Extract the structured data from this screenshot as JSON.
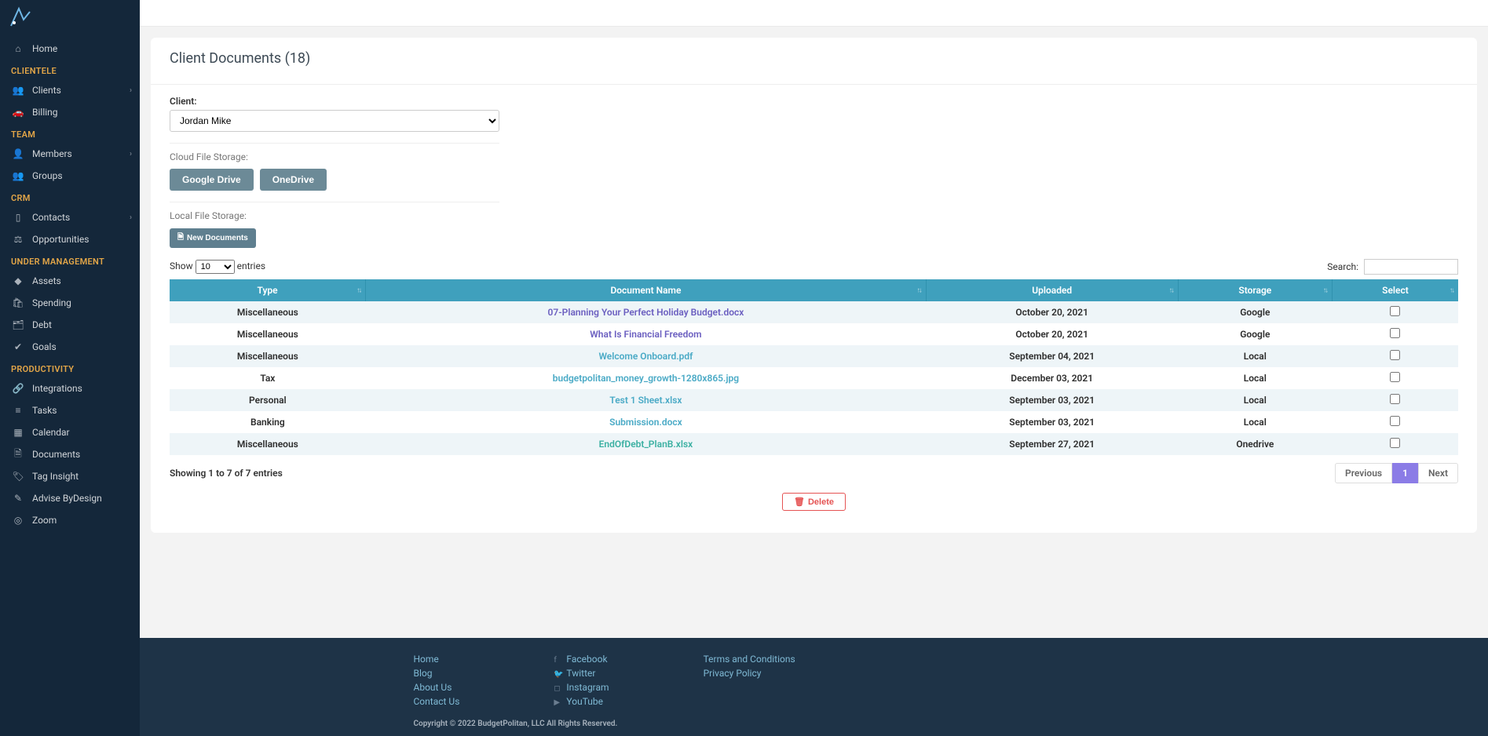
{
  "sidebar": {
    "items": [
      {
        "section": null,
        "label": "Home",
        "icon": "⌂",
        "hasSub": false
      },
      {
        "section": "CLIENTELE",
        "label": "Clients",
        "icon": "👥",
        "hasSub": true
      },
      {
        "section": null,
        "label": "Billing",
        "icon": "🚗",
        "hasSub": false
      },
      {
        "section": "TEAM",
        "label": "Members",
        "icon": "👤",
        "hasSub": true
      },
      {
        "section": null,
        "label": "Groups",
        "icon": "👥",
        "hasSub": false
      },
      {
        "section": "CRM",
        "label": "Contacts",
        "icon": "▯",
        "hasSub": true
      },
      {
        "section": null,
        "label": "Opportunities",
        "icon": "⚖",
        "hasSub": false
      },
      {
        "section": "UNDER MANAGEMENT",
        "label": "Assets",
        "icon": "◆",
        "hasSub": false
      },
      {
        "section": null,
        "label": "Spending",
        "icon": "🛍",
        "hasSub": false
      },
      {
        "section": null,
        "label": "Debt",
        "icon": "🗂",
        "hasSub": false
      },
      {
        "section": null,
        "label": "Goals",
        "icon": "✔",
        "hasSub": false
      },
      {
        "section": "PRODUCTIVITY",
        "label": "Integrations",
        "icon": "🔗",
        "hasSub": false
      },
      {
        "section": null,
        "label": "Tasks",
        "icon": "≡",
        "hasSub": false
      },
      {
        "section": null,
        "label": "Calendar",
        "icon": "▦",
        "hasSub": false
      },
      {
        "section": null,
        "label": "Documents",
        "icon": "🗎",
        "hasSub": false
      },
      {
        "section": null,
        "label": "Tag Insight",
        "icon": "🏷",
        "hasSub": false
      },
      {
        "section": null,
        "label": "Advise ByDesign",
        "icon": "✎",
        "hasSub": false
      },
      {
        "section": null,
        "label": "Zoom",
        "icon": "◎",
        "hasSub": false
      }
    ]
  },
  "page": {
    "title": "Client Documents (18)",
    "client_label": "Client:",
    "client_selected": "Jordan Mike",
    "cloud_label": "Cloud File Storage:",
    "btn_gdrive": "Google Drive",
    "btn_onedrive": "OneDrive",
    "local_label": "Local File Storage:",
    "btn_newdoc": "New Documents",
    "show_label_a": "Show",
    "show_value": "10",
    "show_label_b": "entries",
    "search_label": "Search:",
    "delete_label": "Delete",
    "info_text": "Showing 1 to 7 of 7 entries",
    "pager_prev": "Previous",
    "pager_page": "1",
    "pager_next": "Next"
  },
  "table": {
    "headers": [
      "Type",
      "Document Name",
      "Uploaded",
      "Storage",
      "Select"
    ],
    "rows": [
      {
        "type": "Miscellaneous",
        "name": "07-Planning Your Perfect Holiday Budget.docx",
        "uploaded": "October 20, 2021",
        "storage": "Google",
        "link_class": "purple"
      },
      {
        "type": "Miscellaneous",
        "name": "What Is Financial Freedom",
        "uploaded": "October 20, 2021",
        "storage": "Google",
        "link_class": "purple"
      },
      {
        "type": "Miscellaneous",
        "name": "Welcome Onboard.pdf",
        "uploaded": "September 04, 2021",
        "storage": "Local",
        "link_class": ""
      },
      {
        "type": "Tax",
        "name": "budgetpolitan_money_growth-1280x865.jpg",
        "uploaded": "December 03, 2021",
        "storage": "Local",
        "link_class": ""
      },
      {
        "type": "Personal",
        "name": "Test 1 Sheet.xlsx",
        "uploaded": "September 03, 2021",
        "storage": "Local",
        "link_class": ""
      },
      {
        "type": "Banking",
        "name": "Submission.docx",
        "uploaded": "September 03, 2021",
        "storage": "Local",
        "link_class": ""
      },
      {
        "type": "Miscellaneous",
        "name": "EndOfDebt_PlanB.xlsx",
        "uploaded": "September 27, 2021",
        "storage": "Onedrive",
        "link_class": "teal"
      }
    ]
  },
  "footer": {
    "col1": [
      "Home",
      "Blog",
      "About Us",
      "Contact Us"
    ],
    "col2": [
      {
        "icon": "f",
        "label": "Facebook"
      },
      {
        "icon": "🐦",
        "label": "Twitter"
      },
      {
        "icon": "◻",
        "label": "Instagram"
      },
      {
        "icon": "▶",
        "label": "YouTube"
      }
    ],
    "col3": [
      "Terms and Conditions",
      "Privacy Policy"
    ],
    "copyright": "Copyright © 2022 BudgetPolitan, LLC All Rights Reserved."
  }
}
